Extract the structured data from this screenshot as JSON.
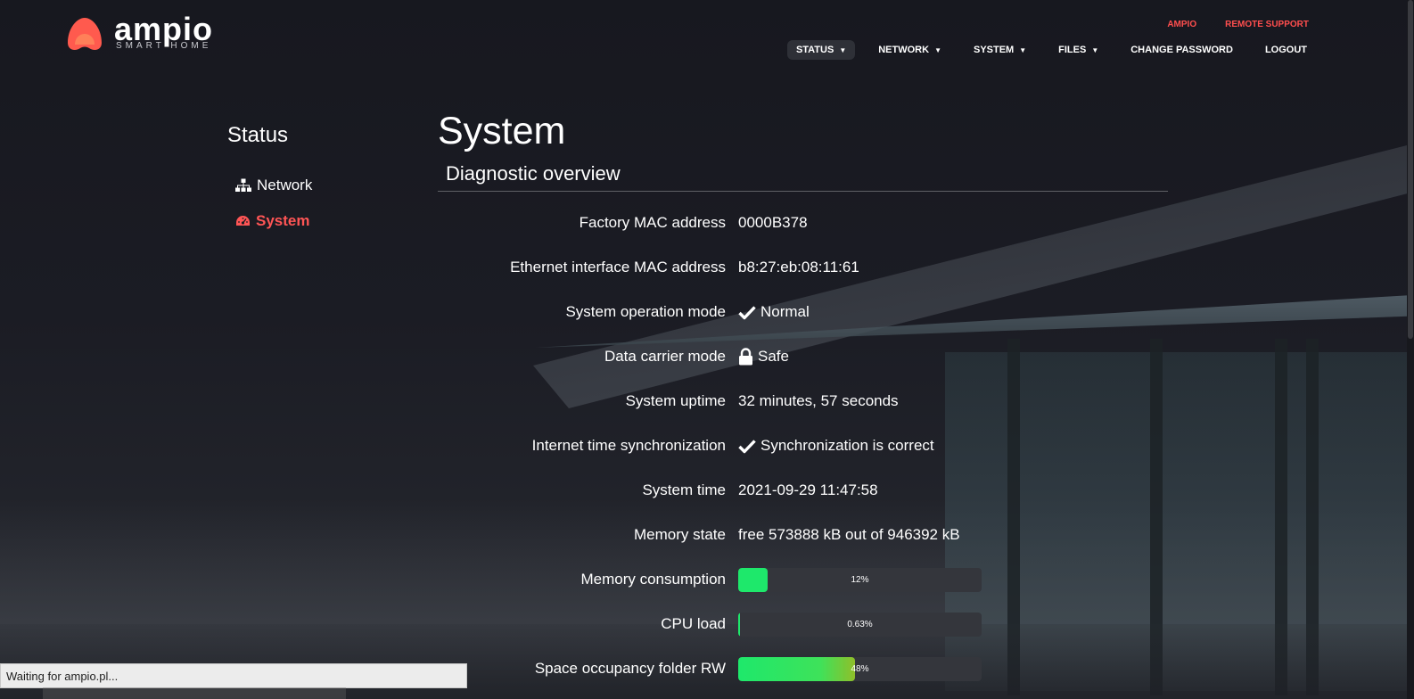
{
  "brand": {
    "name": "ampio",
    "tagline": "SMART HOME",
    "color": "#ff5a4e"
  },
  "top_links": [
    {
      "label": "AMPIO"
    },
    {
      "label": "REMOTE SUPPORT"
    }
  ],
  "nav": [
    {
      "label": "STATUS",
      "caret": "▼",
      "active": true
    },
    {
      "label": "NETWORK",
      "caret": "▼"
    },
    {
      "label": "SYSTEM",
      "caret": "▼"
    },
    {
      "label": "FILES",
      "caret": "▼"
    },
    {
      "label": "CHANGE PASSWORD"
    },
    {
      "label": "LOGOUT"
    }
  ],
  "sidebar": {
    "title": "Status",
    "items": [
      {
        "label": "Network",
        "icon": "sitemap-icon"
      },
      {
        "label": "System",
        "icon": "dashboard-icon",
        "active": true,
        "color": "#ff5555"
      }
    ]
  },
  "page": {
    "title": "System",
    "section": "Diagnostic overview",
    "rows": [
      {
        "label": "Factory MAC address",
        "value": "0000B378"
      },
      {
        "label": "Ethernet interface MAC address",
        "value": "b8:27:eb:08:11:61"
      },
      {
        "label": "System operation mode",
        "value": "Normal",
        "icon": "check-icon"
      },
      {
        "label": "Data carrier mode",
        "value": "Safe",
        "icon": "lock-icon"
      },
      {
        "label": "System uptime",
        "value": "32 minutes, 57 seconds"
      },
      {
        "label": "Internet time synchronization",
        "value": "Synchronization is correct",
        "icon": "check-icon"
      },
      {
        "label": "System time",
        "value": "2021-09-29 11:47:58"
      },
      {
        "label": "Memory state",
        "value": "free 573888 kB out of 946392 kB"
      }
    ],
    "bars": [
      {
        "label": "Memory consumption",
        "percent_text": "12%",
        "fraction": 0.12
      },
      {
        "label": "CPU load",
        "percent_text": "0.63%",
        "fraction": 0.0063
      },
      {
        "label": "Space occupancy folder RW",
        "percent_text": "48%",
        "fraction": 0.48
      }
    ]
  },
  "status_bar": {
    "text": "Waiting for ampio.pl..."
  }
}
